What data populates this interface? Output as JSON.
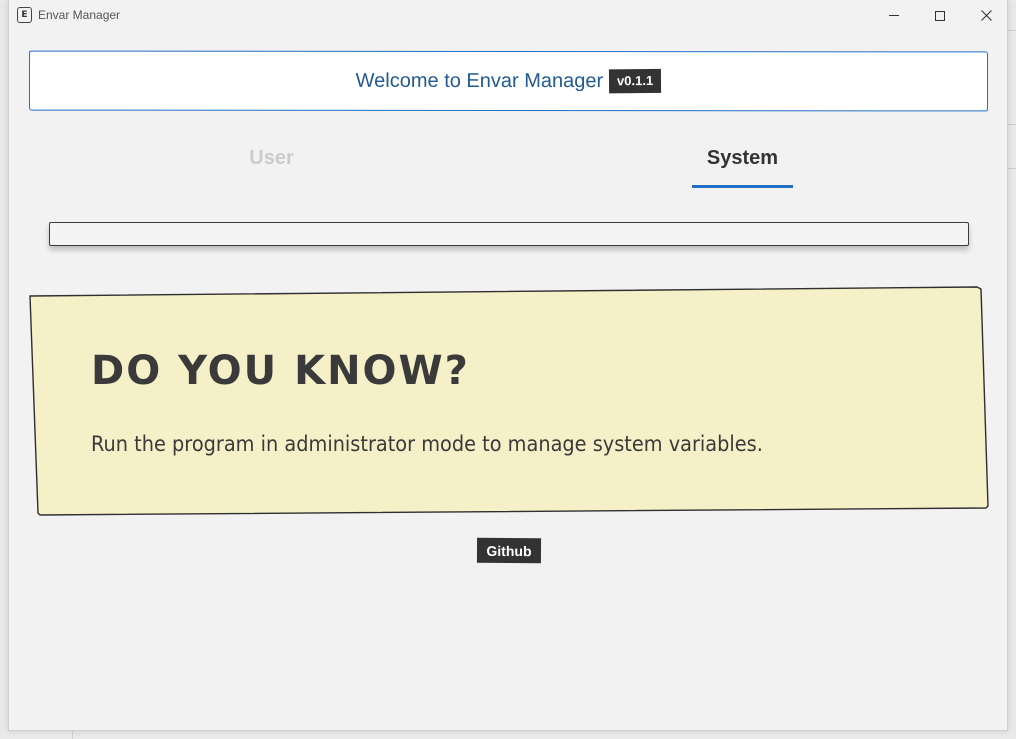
{
  "window": {
    "title": "Envar Manager",
    "icon_letter": "E",
    "controls": [
      "minimize-icon",
      "maximize-icon",
      "close-icon"
    ]
  },
  "header": {
    "welcome_text": "Welcome to Envar Manager",
    "version": "v0.1.1"
  },
  "tabs": [
    {
      "label": "User",
      "active": false
    },
    {
      "label": "System",
      "active": true
    }
  ],
  "search": {
    "value": ""
  },
  "tip": {
    "title": "DO YOU KNOW?",
    "body": "Run the program in administrator mode to manage system variables."
  },
  "footer": {
    "github_label": "Github"
  },
  "colors": {
    "accent": "#1f6fc5",
    "note_background": "#f5f0c8",
    "badge_background": "#333333",
    "inactive_tab": "#cccccc"
  }
}
